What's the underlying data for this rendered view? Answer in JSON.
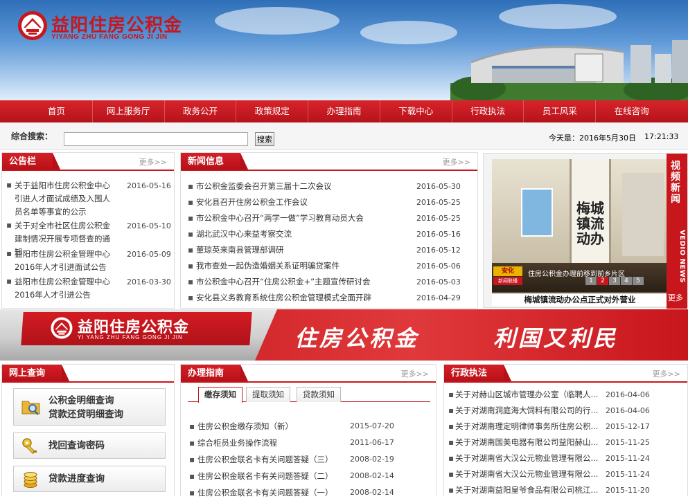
{
  "header": {
    "logo_cn": "益阳住房公积金",
    "logo_pinyin": "YIYANG ZHU FANG GONG JI JIN"
  },
  "nav": [
    "首页",
    "网上服务厅",
    "政务公开",
    "政策规定",
    "办理指南",
    "下载中心",
    "行政执法",
    "员工风采",
    "在线咨询"
  ],
  "search": {
    "label": "综合搜索：",
    "value": "",
    "button": "搜索",
    "date": "今天是：2016年5月30日",
    "time": "17:21:33"
  },
  "notice": {
    "title": "公告栏",
    "more": "更多>>",
    "items": [
      {
        "text": "关于益阳市住房公积金中心引进人才面试成绩及入围人员名单等事宜的公示",
        "date": "2016-05-16"
      },
      {
        "text": "关于对全市社区住房公积金建制情况开展专项督查的通知",
        "date": "2016-05-10"
      },
      {
        "text": "益阳市住房公积金管理中心2016年人才引进面试公告",
        "date": "2016-05-09"
      },
      {
        "text": "益阳市住房公积金管理中心2016年人才引进公告",
        "date": "2016-03-30"
      }
    ]
  },
  "news": {
    "title": "新闻信息",
    "more": "更多>>",
    "items": [
      {
        "text": "市公积金监委会召开第三届十二次会议",
        "date": "2016-05-30"
      },
      {
        "text": "安化县召开住房公积金工作会议",
        "date": "2016-05-25"
      },
      {
        "text": "市公积金中心召开“两学一做”学习教育动员大会",
        "date": "2016-05-25"
      },
      {
        "text": "湖北武汉中心来益考察交流",
        "date": "2016-05-16"
      },
      {
        "text": "董琼英来南县管理部调研",
        "date": "2016-05-12"
      },
      {
        "text": "我市查处一起伪造婚姻关系证明骗贷案件",
        "date": "2016-05-06"
      },
      {
        "text": "市公积金中心召开“住房公积金+”主题宣传研讨会",
        "date": "2016-05-03"
      },
      {
        "text": "安化县义务教育系统住房公积金管理模式全面开辟",
        "date": "2016-04-29"
      }
    ]
  },
  "video": {
    "tab_cn": "视频新闻",
    "tab_en": "VEDIO NEWS",
    "more": "更多",
    "caption": "梅城镇流动办公点正式对外营业",
    "ticker": "住房公积金办理前移到前乡片区",
    "channel": "安化",
    "channel_sub": "新闻联播",
    "pages": [
      "1",
      "2",
      "3",
      "4",
      "5"
    ],
    "sign_text": "梅城镇流动办"
  },
  "banner": {
    "sign_cn": "益阳住房公积金",
    "sign_pinyin": "YI YANG ZHU FANG GONG JI JIN",
    "slogan1": "住房公积金",
    "slogan2": "利国又利民"
  },
  "query": {
    "title": "网上查询",
    "buttons": [
      {
        "line1": "公积金明细查询",
        "line2": "贷款还贷明细查询"
      },
      {
        "line1": "找回查询密码"
      },
      {
        "line1": "贷款进度查询"
      }
    ]
  },
  "guide": {
    "title": "办理指南",
    "more": "更多>>",
    "tabs": [
      "缴存须知",
      "提取须知",
      "贷款须知"
    ],
    "items": [
      {
        "text": "住房公积金缴存须知（新）",
        "date": "2015-07-20"
      },
      {
        "text": "综合柜员业务操作流程",
        "date": "2011-06-17"
      },
      {
        "text": "住房公积金联名卡有关问题答疑（三）",
        "date": "2008-02-19"
      },
      {
        "text": "住房公积金联名卡有关问题答疑（二）",
        "date": "2008-02-14"
      },
      {
        "text": "住房公积金联名卡有关问题答疑（一）",
        "date": "2008-02-14"
      }
    ]
  },
  "law": {
    "title": "行政执法",
    "more": "更多>>",
    "items": [
      {
        "text": "关于对赫山区城市管理办公室（临聘人...",
        "date": "2016-04-06"
      },
      {
        "text": "关于对湖南洞庭海大饲料有限公司的行...",
        "date": "2016-04-06"
      },
      {
        "text": "关于对湖南理定明律师事务所住房公积...",
        "date": "2015-12-17"
      },
      {
        "text": "关于对湖南国美电器有限公司益阳赫山...",
        "date": "2015-11-25"
      },
      {
        "text": "关于对湖南省大汉公元物业管理有限公...",
        "date": "2015-11-24"
      },
      {
        "text": "关于对湖南省大汉公元物业管理有限公...",
        "date": "2015-11-24"
      },
      {
        "text": "关于对湖南益阳皇爷食品有限公司桃江...",
        "date": "2015-11-20"
      }
    ]
  },
  "colors": {
    "brand_red": "#c8161d",
    "nav_red": "#d8242b"
  }
}
